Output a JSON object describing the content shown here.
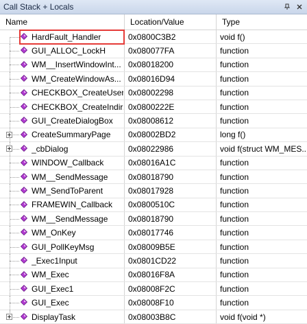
{
  "window": {
    "title": "Call Stack + Locals"
  },
  "columns": {
    "name": "Name",
    "location": "Location/Value",
    "type": "Type"
  },
  "rows": [
    {
      "name": "HardFault_Handler",
      "location": "0x0800C3B2",
      "type": "void f()"
    },
    {
      "name": "GUI_ALLOC_LockH",
      "location": "0x080077FA",
      "type": "function"
    },
    {
      "name": "WM__InsertWindowInt...",
      "location": "0x08018200",
      "type": "function"
    },
    {
      "name": "WM_CreateWindowAs...",
      "location": "0x08016D94",
      "type": "function"
    },
    {
      "name": "CHECKBOX_CreateUser",
      "location": "0x08002298",
      "type": "function"
    },
    {
      "name": "CHECKBOX_CreateIndir...",
      "location": "0x0800222E",
      "type": "function"
    },
    {
      "name": "GUI_CreateDialogBox",
      "location": "0x08008612",
      "type": "function"
    },
    {
      "name": "CreateSummaryPage",
      "location": "0x08002BD2",
      "type": "long f()"
    },
    {
      "name": "_cbDialog",
      "location": "0x08022986",
      "type": "void f(struct WM_MES..."
    },
    {
      "name": "WINDOW_Callback",
      "location": "0x08016A1C",
      "type": "function"
    },
    {
      "name": "WM__SendMessage",
      "location": "0x08018790",
      "type": "function"
    },
    {
      "name": "WM_SendToParent",
      "location": "0x08017928",
      "type": "function"
    },
    {
      "name": "FRAMEWIN_Callback",
      "location": "0x0800510C",
      "type": "function"
    },
    {
      "name": "WM__SendMessage",
      "location": "0x08018790",
      "type": "function"
    },
    {
      "name": "WM_OnKey",
      "location": "0x08017746",
      "type": "function"
    },
    {
      "name": "GUI_PollKeyMsg",
      "location": "0x08009B5E",
      "type": "function"
    },
    {
      "name": "_Exec1Input",
      "location": "0x0801CD22",
      "type": "function"
    },
    {
      "name": "WM_Exec",
      "location": "0x08016F8A",
      "type": "function"
    },
    {
      "name": "GUI_Exec1",
      "location": "0x08008F2C",
      "type": "function"
    },
    {
      "name": "GUI_Exec",
      "location": "0x08008F10",
      "type": "function"
    },
    {
      "name": "DisplayTask",
      "location": "0x08003B8C",
      "type": "void f(void *)"
    }
  ],
  "icons": {
    "function": "function-diamond-icon",
    "pin": "pin-icon",
    "close": "close-icon"
  },
  "colors": {
    "highlight": "#e53a37",
    "function_icon": "#b23ad1"
  }
}
